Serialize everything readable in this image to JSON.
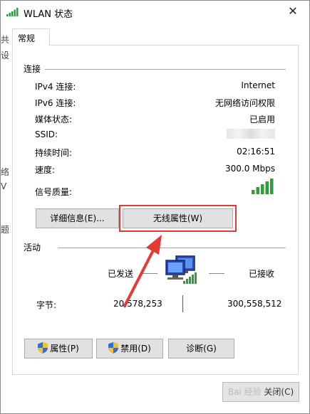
{
  "window": {
    "title": "WLAN 状态"
  },
  "background": {
    "fragments": [
      "共",
      "设",
      "络",
      "V",
      "题"
    ]
  },
  "tab": {
    "label": "常规"
  },
  "connection": {
    "heading": "连接",
    "rows": [
      {
        "label": "IPv4 连接:",
        "value": "Internet"
      },
      {
        "label": "IPv6 连接:",
        "value": "无网络访问权限"
      },
      {
        "label": "媒体状态:",
        "value": "已启用"
      },
      {
        "label": "SSID:",
        "value": ""
      },
      {
        "label": "持续时间:",
        "value": "02:16:51"
      },
      {
        "label": "速度:",
        "value": "300.0 Mbps"
      },
      {
        "label": "信号质量:",
        "value": ""
      }
    ],
    "signal_bars": 5,
    "details_button": "详细信息(E)...",
    "wireless_props_button": "无线属性(W)"
  },
  "activity": {
    "heading": "活动",
    "sent_label": "已发送",
    "received_label": "已接收",
    "bytes_label": "字节:",
    "bytes_sent": "20,578,253",
    "bytes_received": "300,558,512"
  },
  "buttons": {
    "properties": "属性(P)",
    "disable": "禁用(D)",
    "diagnose": "诊断(G)"
  },
  "footer": {
    "close_label": "关闭(C)",
    "watermark": "Bai 经验"
  },
  "colors": {
    "signal": "#2e9e3a",
    "annotation": "#e53935",
    "button_bg": "#e1e1e1"
  }
}
